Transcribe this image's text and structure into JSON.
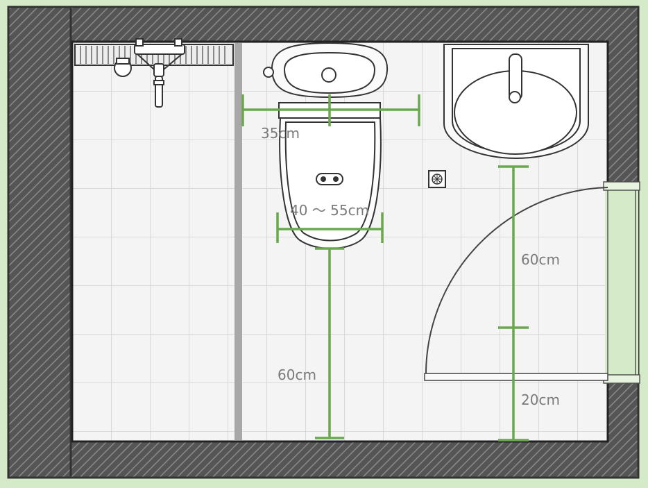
{
  "colors": {
    "background": "#d4eac8",
    "wall": "#5a5a5a",
    "wall_hatch": "#7d7d7d",
    "floor": "#f3f3f3",
    "tile_line": "#d2d2d2",
    "dimension": "#6aa84f",
    "divider": "#a8a8a8",
    "label": "#7a7a7a"
  },
  "icons": [
    "toilet-icon",
    "washbasin-icon",
    "shower-faucet-icon",
    "floor-drain-icon",
    "towel-rack-icon",
    "door-swing-icon"
  ],
  "dimensions": {
    "toilet_front_clearance": "35cm",
    "toilet_seat_width": "40 ～ 55cm",
    "toilet_to_wall": "60cm",
    "sink_clearance": "60cm",
    "sink_to_wall": "20cm"
  }
}
